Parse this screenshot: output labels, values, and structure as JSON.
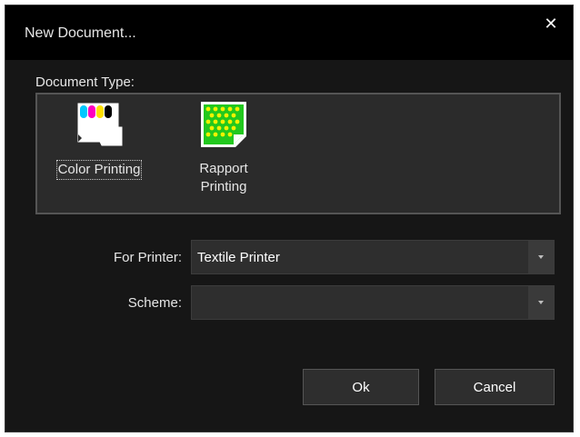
{
  "dialog": {
    "title": "New Document...",
    "close_symbol": "✕"
  },
  "document_type": {
    "label": "Document Type:",
    "items": [
      {
        "label": "Color Printing",
        "icon": "color-printing-icon",
        "selected": true
      },
      {
        "label": "Rapport Printing",
        "icon": "rapport-printing-icon",
        "selected": false
      }
    ]
  },
  "printer": {
    "label": "For Printer:",
    "value": "Textile Printer"
  },
  "scheme": {
    "label": "Scheme:",
    "value": ""
  },
  "buttons": {
    "ok": "Ok",
    "cancel": "Cancel"
  },
  "colors": {
    "background": "#161616",
    "titlebar": "#000000",
    "panel": "#2b2b2b",
    "rapport_green": "#22c81e",
    "rapport_dots": "#f2f200"
  }
}
